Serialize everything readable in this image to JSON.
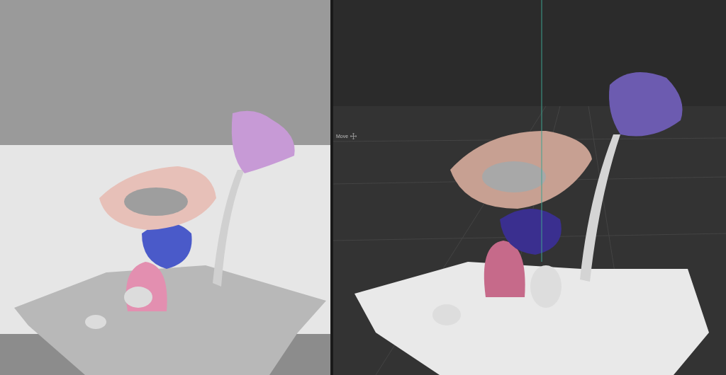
{
  "viewport": {
    "tool_label": "Move"
  }
}
